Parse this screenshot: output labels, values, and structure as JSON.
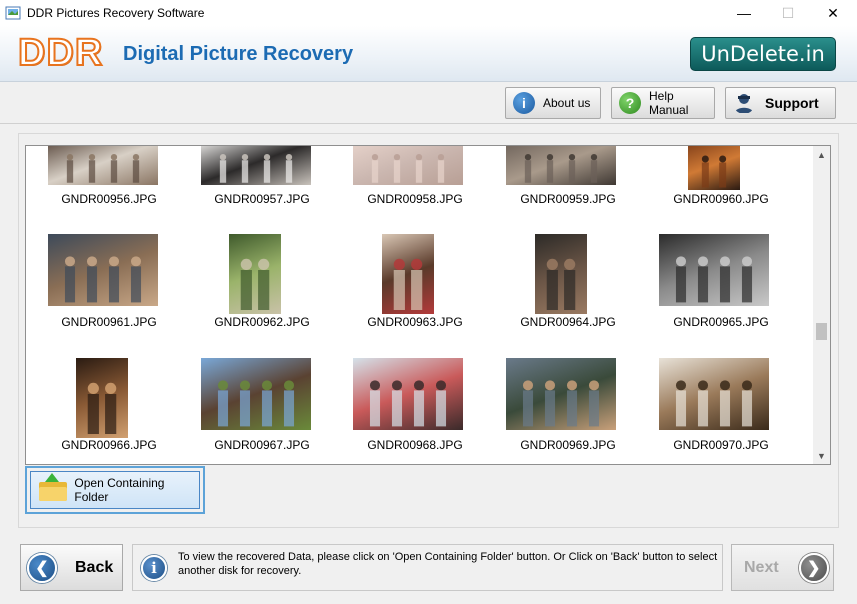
{
  "window": {
    "title": "DDR Pictures Recovery Software",
    "minimize_glyph": "—",
    "maximize_glyph": "☐",
    "close_glyph": "✕"
  },
  "header": {
    "logo_text": "DDR",
    "product_name": "Digital Picture Recovery",
    "brand_badge": "UnDelete.in",
    "brand_color": "#0d5a5a",
    "logo_color": "#e8741f",
    "title_color": "#1c6bb3"
  },
  "toolbar": {
    "about_label": "About us",
    "help_label": "Help Manual",
    "support_label": "Support",
    "about_icon": "info-icon",
    "help_icon": "question-icon",
    "support_icon": "person-icon"
  },
  "gallery": {
    "files": [
      {
        "name": "GNDR00956.JPG",
        "palette": [
          "#5b4a3f",
          "#d8d0c6",
          "#8a7563"
        ]
      },
      {
        "name": "GNDR00957.JPG",
        "palette": [
          "#f1f0ee",
          "#2c2a2a",
          "#c9c3bc"
        ]
      },
      {
        "name": "GNDR00958.JPG",
        "palette": [
          "#e8d4cc",
          "#cbb7b0",
          "#b89f95"
        ]
      },
      {
        "name": "GNDR00959.JPG",
        "palette": [
          "#6b6058",
          "#a99a8b",
          "#3f3833"
        ]
      },
      {
        "name": "GNDR00960.JPG",
        "palette": [
          "#7a3a17",
          "#d07a35",
          "#2a1a12"
        ]
      },
      {
        "name": "GNDR00961.JPG",
        "palette": [
          "#3d4a5a",
          "#8a6e55",
          "#c9a888"
        ]
      },
      {
        "name": "GNDR00962.JPG",
        "palette": [
          "#3f5a2c",
          "#9ab36a",
          "#c9c2a8"
        ]
      },
      {
        "name": "GNDR00963.JPG",
        "palette": [
          "#d9c7b5",
          "#5a3a2a",
          "#b33a3a"
        ]
      },
      {
        "name": "GNDR00964.JPG",
        "palette": [
          "#2c2a27",
          "#6a5546",
          "#9a7a62"
        ]
      },
      {
        "name": "GNDR00965.JPG",
        "palette": [
          "#2b2b2b",
          "#8a8a8a",
          "#c9c9c9"
        ]
      },
      {
        "name": "GNDR00966.JPG",
        "palette": [
          "#2a1b12",
          "#8a5a35",
          "#d1a070"
        ]
      },
      {
        "name": "GNDR00967.JPG",
        "palette": [
          "#7aa8d8",
          "#5a4232",
          "#6a8a3a"
        ]
      },
      {
        "name": "GNDR00968.JPG",
        "palette": [
          "#d5e2ea",
          "#c95a5a",
          "#3a2a2a"
        ]
      },
      {
        "name": "GNDR00969.JPG",
        "palette": [
          "#6a7a8a",
          "#3a4a3a",
          "#c9a07a"
        ]
      },
      {
        "name": "GNDR00970.JPG",
        "palette": [
          "#e8e2d8",
          "#9a7a5a",
          "#3a2a1a"
        ]
      }
    ]
  },
  "actions": {
    "open_folder_label": "Open Containing Folder",
    "back_label": "Back",
    "next_label": "Next",
    "info_text": "To view the recovered Data, please click on 'Open Containing Folder' button. Or Click on 'Back' button to select another disk for recovery."
  }
}
